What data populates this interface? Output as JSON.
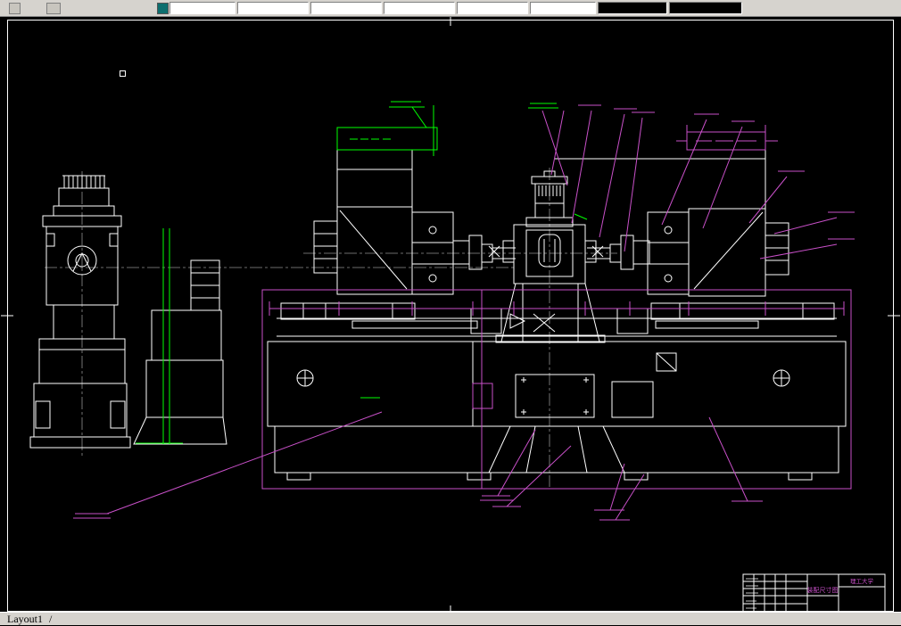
{
  "toolbar": {
    "controls": [
      "app-icon",
      "tool-button",
      "color-swatch-icon",
      "dropdown",
      "dropdown",
      "dropdown",
      "dropdown",
      "dropdown",
      "dropdown",
      "dropdown-dark",
      "dropdown-dark"
    ]
  },
  "layout_tabs": {
    "active_tab": "Layout1",
    "separator": "/"
  },
  "title_block": {
    "drawing_title": "装配尺寸图",
    "organization": "理工大学"
  },
  "colors": {
    "canvas_bg": "#000000",
    "geometry": "#ffffff",
    "dimension": "#c850c8",
    "highlight": "#00ff00",
    "toolbar_bg": "#d6d3ce",
    "swatch_teal": "#0d6e6e"
  }
}
